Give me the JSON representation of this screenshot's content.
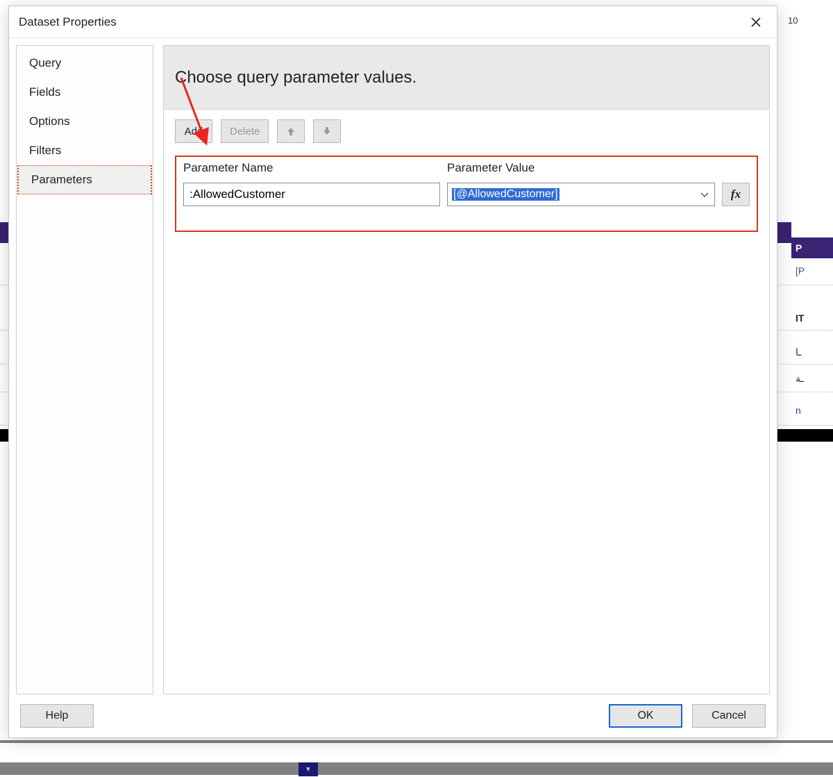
{
  "dialog": {
    "title": "Dataset Properties",
    "close_label": "Close"
  },
  "nav": {
    "items": [
      {
        "label": "Query",
        "selected": false
      },
      {
        "label": "Fields",
        "selected": false
      },
      {
        "label": "Options",
        "selected": false
      },
      {
        "label": "Filters",
        "selected": false
      },
      {
        "label": "Parameters",
        "selected": true
      }
    ]
  },
  "content": {
    "heading": "Choose query parameter values.",
    "toolbar": {
      "add_label": "Add",
      "delete_label": "Delete",
      "up_name": "move-up",
      "down_name": "move-down"
    },
    "columns": {
      "name": "Parameter Name",
      "value": "Parameter Value"
    },
    "rows": [
      {
        "name": ":AllowedCustomer",
        "value_display": "[@AllowedCustomer]"
      }
    ],
    "fx_label": "fx"
  },
  "footer": {
    "help_label": "Help",
    "ok_label": "OK",
    "cancel_label": "Cancel"
  },
  "background": {
    "col_header": "P",
    "cell1": "[P",
    "col_header2": "IT",
    "cell2a": "ـا",
    "cell2b": "ـة",
    "cell2c": "n",
    "right_num": "10"
  }
}
